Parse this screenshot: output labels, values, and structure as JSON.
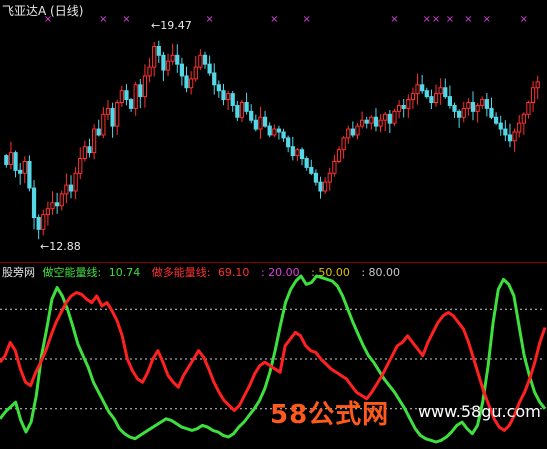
{
  "title": {
    "stock": "飞亚达A",
    "period": "(日线)"
  },
  "price_markers": {
    "high": "19.47",
    "low": "12.88"
  },
  "indicator": {
    "name": "股旁网",
    "short_label": "做空能量线:",
    "short_value": "10.74",
    "long_label": "做多能量线:",
    "long_value": "69.10",
    "level1": "20.00",
    "level2": "50.00",
    "level3": "80.00"
  },
  "watermark": {
    "brand": "58公式网",
    "url": "www.58gu.com"
  },
  "colors": {
    "up": "#ff3030",
    "down": "#54d8e8",
    "short_line": "#3ee03e",
    "long_line": "#ff2020",
    "marker": "#e040e0"
  },
  "chart_data": [
    {
      "type": "candlestick",
      "title": "飞亚达A (日线)",
      "ylim": [
        12.3,
        20.3
      ],
      "annotations": [
        {
          "text": "19.47",
          "kind": "high"
        },
        {
          "text": "12.88",
          "kind": "low"
        }
      ],
      "closes": [
        15.2,
        15.6,
        15.0,
        14.9,
        15.3,
        14.4,
        13.4,
        13.0,
        13.5,
        13.7,
        13.9,
        13.8,
        14.2,
        14.5,
        14.3,
        14.9,
        15.4,
        15.8,
        15.6,
        16.4,
        16.2,
        16.9,
        17.1,
        16.5,
        17.3,
        17.7,
        17.4,
        17.1,
        17.9,
        17.5,
        18.2,
        18.5,
        19.2,
        18.9,
        18.4,
        18.7,
        18.9,
        18.6,
        18.2,
        17.8,
        18.1,
        18.5,
        18.9,
        18.6,
        18.3,
        17.9,
        17.7,
        17.4,
        17.6,
        17.2,
        16.8,
        17.3,
        17.0,
        16.7,
        16.4,
        16.8,
        16.5,
        16.2,
        16.4,
        16.3,
        16.1,
        15.8,
        15.5,
        15.7,
        15.4,
        15.1,
        14.9,
        14.6,
        14.3,
        14.6,
        14.9,
        15.3,
        15.7,
        16.1,
        16.4,
        16.2,
        16.5,
        16.7,
        16.6,
        16.8,
        16.5,
        16.7,
        16.9,
        16.6,
        17.0,
        17.2,
        17.1,
        17.4,
        17.6,
        17.9,
        17.7,
        17.5,
        17.3,
        17.6,
        17.8,
        17.5,
        17.2,
        17.0,
        16.8,
        17.1,
        17.3,
        17.0,
        17.2,
        17.4,
        17.1,
        16.8,
        16.6,
        16.4,
        16.2,
        16.0,
        16.3,
        16.6,
        16.9,
        17.3,
        17.8,
        18.0
      ],
      "markers_x_index": [
        9,
        21,
        26,
        44,
        58,
        65,
        84,
        91,
        93,
        96,
        100,
        104,
        112
      ],
      "marker_symbol": "×"
    },
    {
      "type": "line",
      "title": "股旁网",
      "ylim": [
        0,
        100
      ],
      "hlines": [
        20,
        50,
        80
      ],
      "series": [
        {
          "name": "做空能量线",
          "values": [
            14,
            18,
            21,
            24,
            13,
            6,
            12,
            28,
            52,
            68,
            86,
            93,
            88,
            80,
            70,
            59,
            52,
            45,
            36,
            30,
            24,
            18,
            14,
            8,
            5,
            3,
            2,
            4,
            6,
            8,
            10,
            12,
            14,
            13,
            11,
            9,
            8,
            7,
            8,
            10,
            9,
            7,
            6,
            4,
            3,
            5,
            9,
            12,
            16,
            20,
            25,
            32,
            42,
            55,
            70,
            84,
            92,
            97,
            100,
            95,
            96,
            100,
            99,
            98,
            97,
            94,
            88,
            80,
            72,
            65,
            58,
            52,
            48,
            43,
            38,
            34,
            30,
            25,
            20,
            14,
            8,
            4,
            2,
            1,
            0,
            1,
            3,
            6,
            10,
            12,
            8,
            5,
            10,
            24,
            45,
            72,
            92,
            98,
            95,
            88,
            70,
            52,
            40,
            30,
            24,
            20
          ]
        },
        {
          "name": "做多能量线",
          "values": [
            48,
            52,
            60,
            55,
            44,
            36,
            34,
            42,
            48,
            55,
            64,
            72,
            78,
            84,
            88,
            90,
            89,
            86,
            84,
            88,
            82,
            84,
            79,
            73,
            64,
            50,
            43,
            38,
            36,
            42,
            50,
            55,
            48,
            40,
            36,
            33,
            40,
            45,
            50,
            55,
            51,
            44,
            36,
            30,
            25,
            22,
            19,
            22,
            28,
            34,
            41,
            46,
            48,
            46,
            44,
            42,
            58,
            62,
            66,
            64,
            58,
            55,
            54,
            50,
            47,
            44,
            42,
            40,
            38,
            34,
            30,
            28,
            26,
            30,
            35,
            40,
            46,
            52,
            58,
            60,
            64,
            60,
            56,
            52,
            60,
            66,
            72,
            76,
            78,
            76,
            72,
            68,
            60,
            50,
            40,
            30,
            22,
            14,
            9,
            7,
            10,
            16,
            24,
            30,
            38,
            48,
            60,
            69
          ]
        }
      ]
    }
  ]
}
